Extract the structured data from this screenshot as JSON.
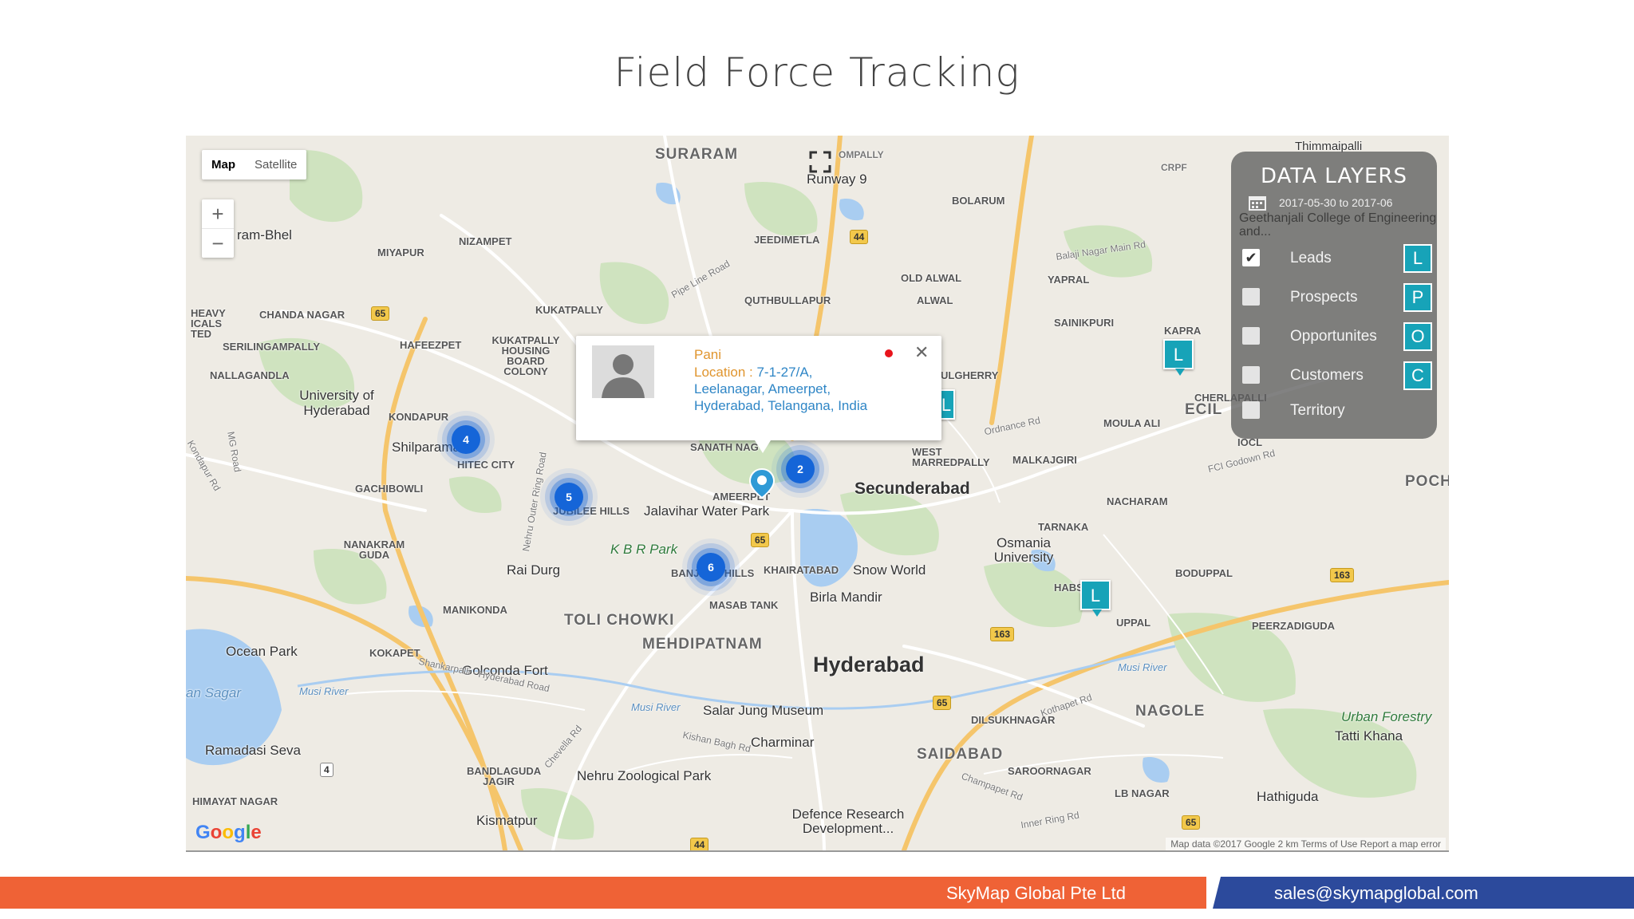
{
  "slide": {
    "title": "Field Force Tracking"
  },
  "map": {
    "type_control": {
      "map": "Map",
      "satellite": "Satellite"
    },
    "zoom": {
      "in": "+",
      "out": "−"
    },
    "labels": {
      "suraram": "SURARAM",
      "runway9": "Runway 9",
      "ompally": "OMPALLY",
      "crpf": "CRPF",
      "thimmaipalli": "Thimmaipalli",
      "bolarum": "BOLARUM",
      "nizampet": "NIZAMPET",
      "jeedimetla": "JEEDIMETLA",
      "miyapur": "MIYAPUR",
      "chandanagar": "CHANDA NAGAR",
      "kukatpally": "KUKATPALLY",
      "kukatpally_housing": "KUKATPALLY HOUSING BOARD COLONY",
      "quthbullapur": "QUTHBULLAPUR",
      "old_alwal": "OLD ALWAL",
      "alwal": "ALWAL",
      "yapral": "YAPRAL",
      "sainikpuri": "SAINIKPURI",
      "kapra": "KAPRA",
      "ecil": "ECIL",
      "serilingampally": "SERILINGAMPALLY",
      "hafeezpet": "HAFEEZPET",
      "nallagandla": "NALLAGANDLA",
      "uni_hyd": "University of Hyderabad",
      "kondapur": "KONDAPUR",
      "shilparamam": "Shilparamam",
      "hitec": "HITEC CITY",
      "gachibowli": "GACHIBOWLI",
      "jubilee": "JUBILEE HILLS",
      "jalavihar": "Jalavihar Water Park",
      "ameerpet": "AMEERPET",
      "secunderabad": "Secunderabad",
      "west_marredpally": "WEST MARREDPALLY",
      "malkajgiri": "MALKAJGIRI",
      "moula_ali": "MOULA ALI",
      "nacharam": "NACHARAM",
      "tarnaka": "TARNAKA",
      "osmania": "Osmania University",
      "boduppal": "BODUPPAL",
      "habsiguda": "HABSI",
      "uppal": "UPPAL",
      "peerzadiguda": "PEERZADIGUDA",
      "pocharam": "POCH",
      "kbr": "K B R Park",
      "nanakram": "NANAKRAM GUDA",
      "rai_durg": "Rai Durg",
      "banjara": "BANJARA HILLS",
      "khairatabad": "KHAIRATABAD",
      "snow_world": "Snow World",
      "masab": "MASAB TANK",
      "birla": "Birla Mandir",
      "manikonda": "MANIKONDA",
      "toli": "TOLI CHOWKI",
      "mehdipatnam": "MEHDIPATNAM",
      "hyderabad": "Hyderabad",
      "ocean_park": "Ocean Park",
      "kokapet": "KOKAPET",
      "golconda": "Golconda Fort",
      "osman_sagar": "an Sagar",
      "salarjung": "Salar Jung Museum",
      "nagole": "NAGOLE",
      "urban_forestry": "Urban Forestry",
      "tatti_khana": "Tatti Khana",
      "charminar": "Charminar",
      "saidabad": "SAIDABAD",
      "dilsukhnagar": "DILSUKHNAGAR",
      "ramadasi": "Ramadasi Seva",
      "bandlaguda": "BANDLAGUDA JAGIR",
      "nehru_zoo": "Nehru Zoological Park",
      "saroornagar": "SAROORNAGAR",
      "lb_nagar": "LB NAGAR",
      "himayat": "HIMAYAT NAGAR",
      "hathiguda": "Hathiguda",
      "kismatpur": "Kismatpur",
      "defence": "Defence Research Development...",
      "heavy": "HEAVY ICALS TED",
      "ram_bhel": "ram-Bhel",
      "sanath": "SANATH NAG",
      "ulgherry": "ULGHERRY",
      "cherlapalli": "CHERLAPALLI",
      "iocl": "IOCL",
      "musi_river": "Musi River",
      "musi_river2": "Musi River",
      "musi_river3": "Musi River",
      "nehru_orr": "Nehru Outer Ring Road",
      "balaji_rd": "Balaji Nagar Main Rd",
      "pipe_line": "Pipe Line Road",
      "ordnance": "Ordnance Rd",
      "fci_godown": "FCI Godown Rd",
      "kothapet": "Kothapet Rd",
      "champapet": "Champapet Rd",
      "inner_ring": "Inner Ring Rd",
      "kishan_bagh": "Kishan Bagh Rd",
      "shankarpalli": "Shankarpalli - Hyderabad Road",
      "chevella": "Chevella Rd",
      "mg_road": "MG Road",
      "kondapur_rd": "Kondapur Rd"
    },
    "shields": [
      "65",
      "44",
      "65",
      "65",
      "163",
      "163",
      "65",
      "4",
      "65",
      "44"
    ],
    "clusters": [
      "4",
      "5",
      "2",
      "6"
    ],
    "lead_markers": [
      "L",
      "L",
      "L"
    ],
    "info_window": {
      "name": "Pani",
      "location_key": "Location : ",
      "address": "7-1-27/A, Leelanagar, Ameerpet, Hyderabad, Telangana, India",
      "close": "✕"
    },
    "data_layers": {
      "title": "DATA LAYERS",
      "date_range": "2017-05-30 to 2017-06",
      "overlay_text": "Geethanjali College of Engineering and...",
      "layers": [
        {
          "name": "Leads",
          "checked": true,
          "badge": "L"
        },
        {
          "name": "Prospects",
          "checked": false,
          "badge": "P"
        },
        {
          "name": "Opportunites",
          "checked": false,
          "badge": "O"
        },
        {
          "name": "Customers",
          "checked": false,
          "badge": "C"
        },
        {
          "name": "Territory",
          "checked": false,
          "badge": ""
        }
      ],
      "check": "✔"
    },
    "attribution": "Map data ©2017 Google   2 km   Terms of Use   Report a map error",
    "google": "Google"
  },
  "footer": {
    "company": "SkyMap Global Pte Ltd",
    "email": "sales@skymapglobal.com"
  },
  "colors": {
    "orange": "#ef6236",
    "blue": "#2c4a9c",
    "teal": "#17a3b8",
    "cluster": "#1565d8"
  }
}
